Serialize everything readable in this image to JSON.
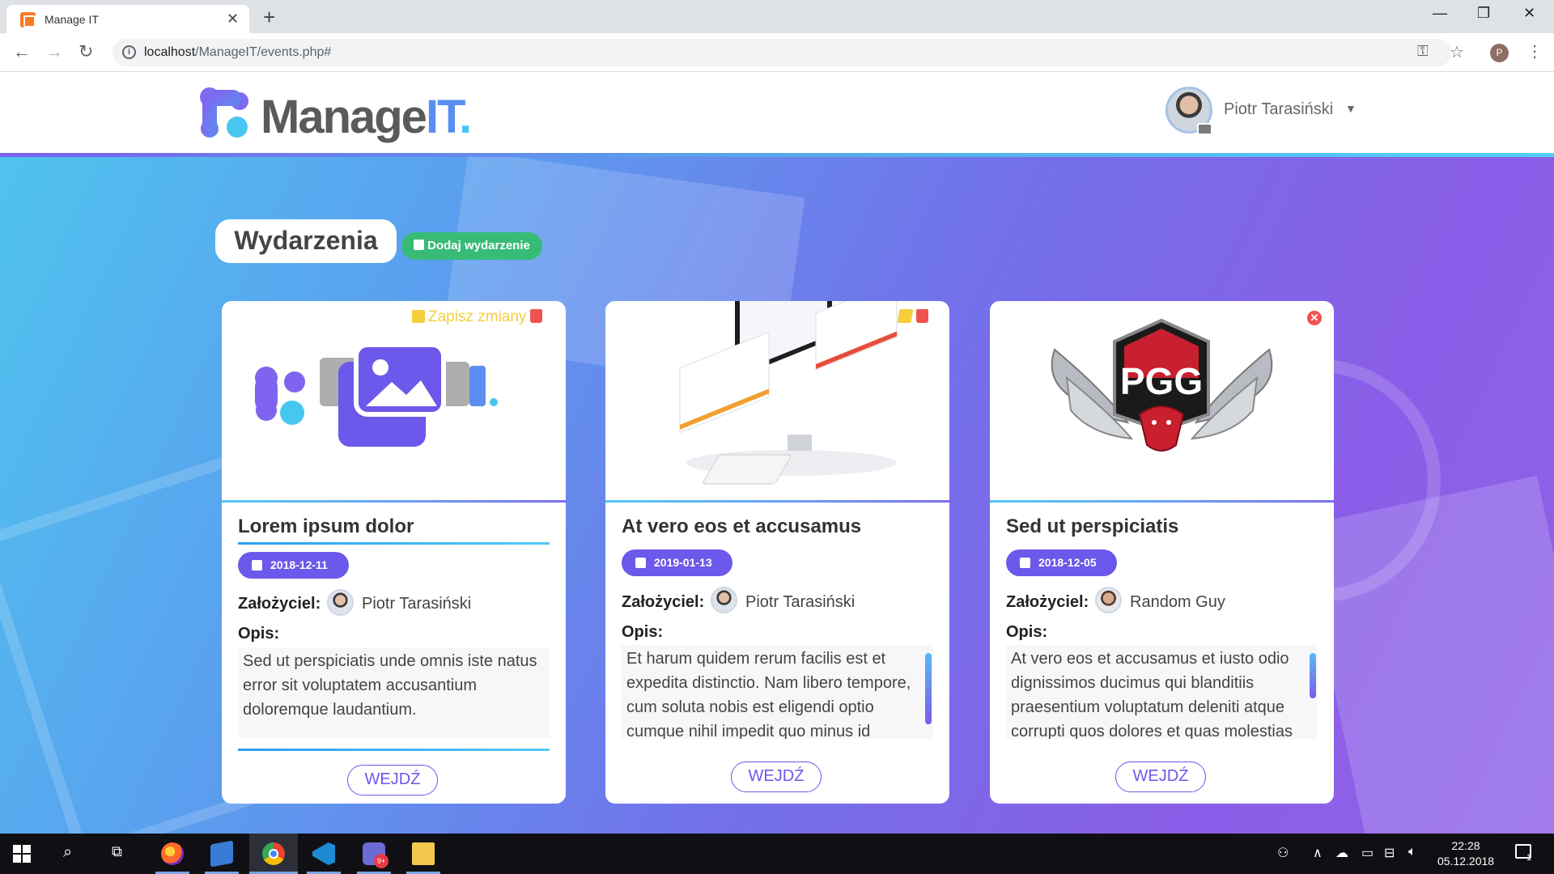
{
  "browser": {
    "tab_title": "Manage IT",
    "url_host": "localhost",
    "url_path": "/ManageIT/events.php#",
    "profile_initial": "P"
  },
  "header": {
    "logo_main": "Manage",
    "logo_it": "IT",
    "logo_dot": ".",
    "user_name": "Piotr Tarasiński"
  },
  "page": {
    "title": "Wydarzenia",
    "add_event_label": "Dodaj wydarzenie"
  },
  "labels": {
    "founder": "Założyciel:",
    "description": "Opis:",
    "enter": "WEJDŹ",
    "save_changes": "Zapisz zmiany"
  },
  "cards": [
    {
      "title": "Lorem ipsum dolor",
      "date": "2018-12-11",
      "founder": "Piotr Tarasiński",
      "description": "Sed ut perspiciatis unde omnis iste natus error sit voluptatem accusantium doloremque laudantium.",
      "mode": "editing"
    },
    {
      "title": "At vero eos et accusamus",
      "date": "2019-01-13",
      "founder": "Piotr Tarasiński",
      "description": "Et harum quidem rerum facilis est et expedita distinctio. Nam libero tempore, cum soluta nobis est eligendi optio cumque nihil impedit quo minus id",
      "mode": "owner"
    },
    {
      "title": "Sed ut perspiciatis",
      "date": "2018-12-05",
      "founder": "Random Guy",
      "description": "At vero eos et accusamus et iusto odio dignissimos ducimus qui blanditiis praesentium voluptatum deleniti atque corrupti quos dolores et quas molestias",
      "mode": "member",
      "logo_text": "PGG"
    }
  ],
  "taskbar": {
    "time": "22:28",
    "date": "05.12.2018",
    "notification_count": "1"
  },
  "colors": {
    "accent_purple": "#6c58ea",
    "add_button_green": "#37bc78",
    "save_yellow": "#f5ce3c",
    "delete_red": "#ef5350"
  }
}
